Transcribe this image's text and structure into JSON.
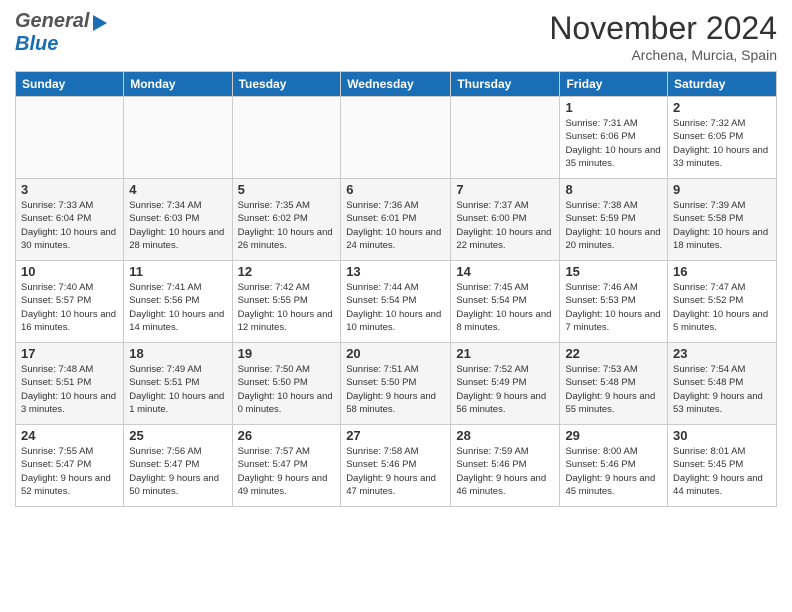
{
  "header": {
    "logo_general": "General",
    "logo_blue": "Blue",
    "month": "November 2024",
    "location": "Archena, Murcia, Spain"
  },
  "days_of_week": [
    "Sunday",
    "Monday",
    "Tuesday",
    "Wednesday",
    "Thursday",
    "Friday",
    "Saturday"
  ],
  "weeks": [
    [
      {
        "day": "",
        "info": ""
      },
      {
        "day": "",
        "info": ""
      },
      {
        "day": "",
        "info": ""
      },
      {
        "day": "",
        "info": ""
      },
      {
        "day": "",
        "info": ""
      },
      {
        "day": "1",
        "info": "Sunrise: 7:31 AM\nSunset: 6:06 PM\nDaylight: 10 hours and 35 minutes."
      },
      {
        "day": "2",
        "info": "Sunrise: 7:32 AM\nSunset: 6:05 PM\nDaylight: 10 hours and 33 minutes."
      }
    ],
    [
      {
        "day": "3",
        "info": "Sunrise: 7:33 AM\nSunset: 6:04 PM\nDaylight: 10 hours and 30 minutes."
      },
      {
        "day": "4",
        "info": "Sunrise: 7:34 AM\nSunset: 6:03 PM\nDaylight: 10 hours and 28 minutes."
      },
      {
        "day": "5",
        "info": "Sunrise: 7:35 AM\nSunset: 6:02 PM\nDaylight: 10 hours and 26 minutes."
      },
      {
        "day": "6",
        "info": "Sunrise: 7:36 AM\nSunset: 6:01 PM\nDaylight: 10 hours and 24 minutes."
      },
      {
        "day": "7",
        "info": "Sunrise: 7:37 AM\nSunset: 6:00 PM\nDaylight: 10 hours and 22 minutes."
      },
      {
        "day": "8",
        "info": "Sunrise: 7:38 AM\nSunset: 5:59 PM\nDaylight: 10 hours and 20 minutes."
      },
      {
        "day": "9",
        "info": "Sunrise: 7:39 AM\nSunset: 5:58 PM\nDaylight: 10 hours and 18 minutes."
      }
    ],
    [
      {
        "day": "10",
        "info": "Sunrise: 7:40 AM\nSunset: 5:57 PM\nDaylight: 10 hours and 16 minutes."
      },
      {
        "day": "11",
        "info": "Sunrise: 7:41 AM\nSunset: 5:56 PM\nDaylight: 10 hours and 14 minutes."
      },
      {
        "day": "12",
        "info": "Sunrise: 7:42 AM\nSunset: 5:55 PM\nDaylight: 10 hours and 12 minutes."
      },
      {
        "day": "13",
        "info": "Sunrise: 7:44 AM\nSunset: 5:54 PM\nDaylight: 10 hours and 10 minutes."
      },
      {
        "day": "14",
        "info": "Sunrise: 7:45 AM\nSunset: 5:54 PM\nDaylight: 10 hours and 8 minutes."
      },
      {
        "day": "15",
        "info": "Sunrise: 7:46 AM\nSunset: 5:53 PM\nDaylight: 10 hours and 7 minutes."
      },
      {
        "day": "16",
        "info": "Sunrise: 7:47 AM\nSunset: 5:52 PM\nDaylight: 10 hours and 5 minutes."
      }
    ],
    [
      {
        "day": "17",
        "info": "Sunrise: 7:48 AM\nSunset: 5:51 PM\nDaylight: 10 hours and 3 minutes."
      },
      {
        "day": "18",
        "info": "Sunrise: 7:49 AM\nSunset: 5:51 PM\nDaylight: 10 hours and 1 minute."
      },
      {
        "day": "19",
        "info": "Sunrise: 7:50 AM\nSunset: 5:50 PM\nDaylight: 10 hours and 0 minutes."
      },
      {
        "day": "20",
        "info": "Sunrise: 7:51 AM\nSunset: 5:50 PM\nDaylight: 9 hours and 58 minutes."
      },
      {
        "day": "21",
        "info": "Sunrise: 7:52 AM\nSunset: 5:49 PM\nDaylight: 9 hours and 56 minutes."
      },
      {
        "day": "22",
        "info": "Sunrise: 7:53 AM\nSunset: 5:48 PM\nDaylight: 9 hours and 55 minutes."
      },
      {
        "day": "23",
        "info": "Sunrise: 7:54 AM\nSunset: 5:48 PM\nDaylight: 9 hours and 53 minutes."
      }
    ],
    [
      {
        "day": "24",
        "info": "Sunrise: 7:55 AM\nSunset: 5:47 PM\nDaylight: 9 hours and 52 minutes."
      },
      {
        "day": "25",
        "info": "Sunrise: 7:56 AM\nSunset: 5:47 PM\nDaylight: 9 hours and 50 minutes."
      },
      {
        "day": "26",
        "info": "Sunrise: 7:57 AM\nSunset: 5:47 PM\nDaylight: 9 hours and 49 minutes."
      },
      {
        "day": "27",
        "info": "Sunrise: 7:58 AM\nSunset: 5:46 PM\nDaylight: 9 hours and 47 minutes."
      },
      {
        "day": "28",
        "info": "Sunrise: 7:59 AM\nSunset: 5:46 PM\nDaylight: 9 hours and 46 minutes."
      },
      {
        "day": "29",
        "info": "Sunrise: 8:00 AM\nSunset: 5:46 PM\nDaylight: 9 hours and 45 minutes."
      },
      {
        "day": "30",
        "info": "Sunrise: 8:01 AM\nSunset: 5:45 PM\nDaylight: 9 hours and 44 minutes."
      }
    ]
  ]
}
